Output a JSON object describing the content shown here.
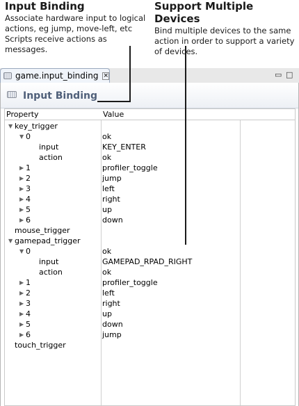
{
  "annotations": {
    "left": {
      "title": "Input Binding",
      "lines": [
        "Associate hardware input to logical",
        "actions, eg jump, move-left, etc",
        "Scripts receive actions as messages."
      ]
    },
    "right": {
      "title": "Support Multiple Devices",
      "lines": [
        "Bind multiple devices to the same",
        "action in order to support a variety",
        "of devices."
      ]
    }
  },
  "tab": {
    "label": "game.input_binding",
    "icon": "keyboard-icon"
  },
  "window_controls": {
    "minimize": "▭",
    "maximize": "□"
  },
  "editor": {
    "title": "Input Binding"
  },
  "table": {
    "headers": {
      "property": "Property",
      "value": "Value"
    },
    "rows": [
      {
        "label": "key_trigger",
        "value": "",
        "level": 0,
        "toggle": "expanded"
      },
      {
        "label": "0",
        "value": "ok",
        "level": 1,
        "toggle": "expanded"
      },
      {
        "label": "input",
        "value": "KEY_ENTER",
        "level": 2,
        "toggle": "none"
      },
      {
        "label": "action",
        "value": "ok",
        "level": 2,
        "toggle": "none"
      },
      {
        "label": "1",
        "value": "profiler_toggle",
        "level": 1,
        "toggle": "collapsed"
      },
      {
        "label": "2",
        "value": "jump",
        "level": 1,
        "toggle": "collapsed"
      },
      {
        "label": "3",
        "value": "left",
        "level": 1,
        "toggle": "collapsed"
      },
      {
        "label": "4",
        "value": "right",
        "level": 1,
        "toggle": "collapsed"
      },
      {
        "label": "5",
        "value": "up",
        "level": 1,
        "toggle": "collapsed"
      },
      {
        "label": "6",
        "value": "down",
        "level": 1,
        "toggle": "collapsed"
      },
      {
        "label": "mouse_trigger",
        "value": "",
        "level": 0,
        "toggle": "none"
      },
      {
        "label": "gamepad_trigger",
        "value": "",
        "level": 0,
        "toggle": "expanded"
      },
      {
        "label": "0",
        "value": "ok",
        "level": 1,
        "toggle": "expanded"
      },
      {
        "label": "input",
        "value": "GAMEPAD_RPAD_RIGHT",
        "level": 2,
        "toggle": "none"
      },
      {
        "label": "action",
        "value": "ok",
        "level": 2,
        "toggle": "none"
      },
      {
        "label": "1",
        "value": "profiler_toggle",
        "level": 1,
        "toggle": "collapsed"
      },
      {
        "label": "2",
        "value": "left",
        "level": 1,
        "toggle": "collapsed"
      },
      {
        "label": "3",
        "value": "right",
        "level": 1,
        "toggle": "collapsed"
      },
      {
        "label": "4",
        "value": "up",
        "level": 1,
        "toggle": "collapsed"
      },
      {
        "label": "5",
        "value": "down",
        "level": 1,
        "toggle": "collapsed"
      },
      {
        "label": "6",
        "value": "jump",
        "level": 1,
        "toggle": "collapsed"
      },
      {
        "label": "touch_trigger",
        "value": "",
        "level": 0,
        "toggle": "none"
      }
    ]
  }
}
